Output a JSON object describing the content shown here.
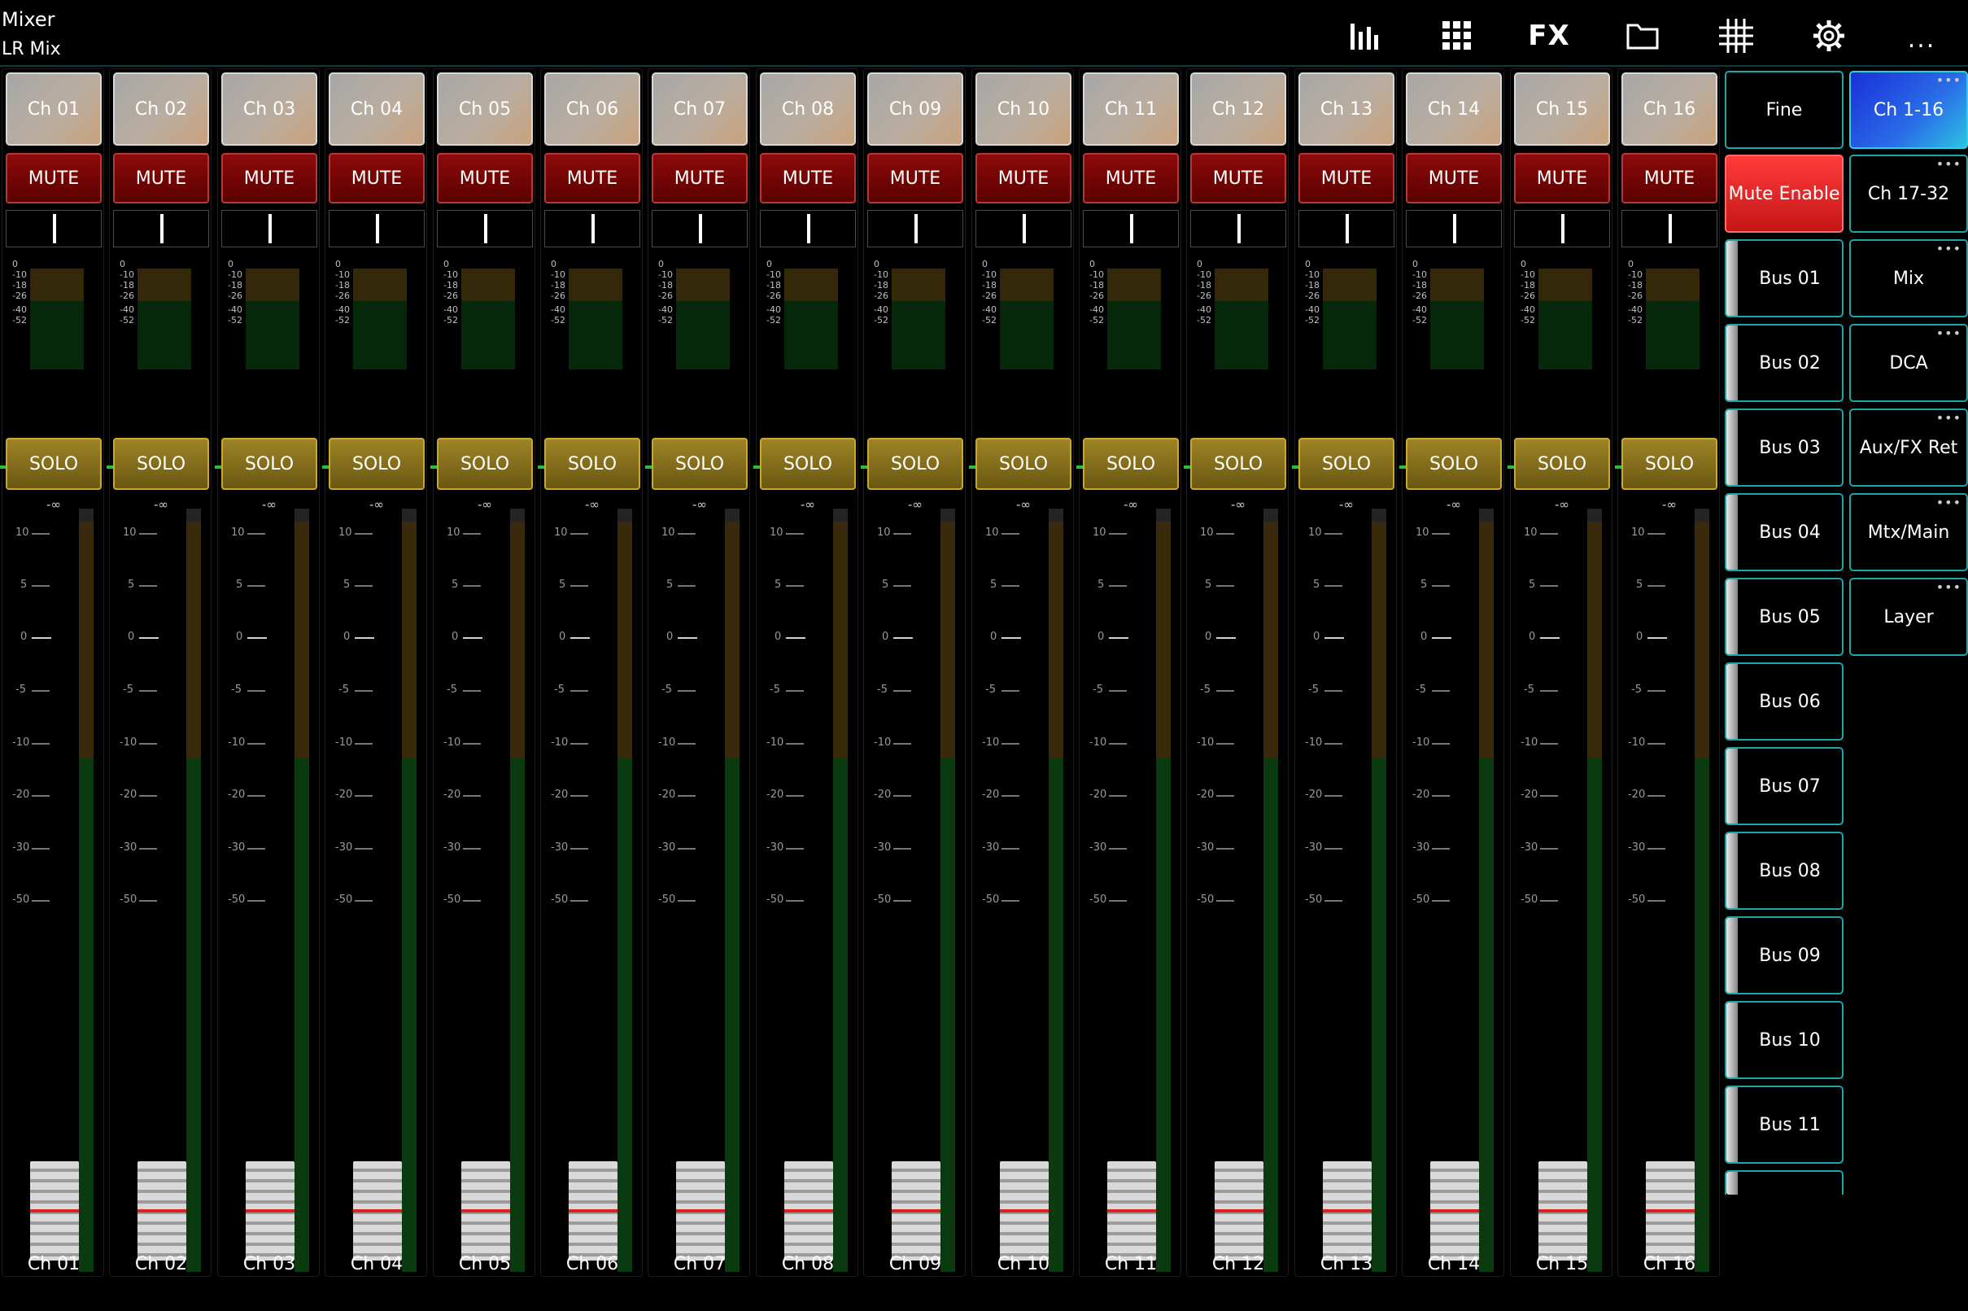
{
  "app": {
    "title": "Mixer",
    "subtitle": "LR Mix"
  },
  "toolbar": {
    "icons": [
      "meters-icon",
      "grid-icon",
      "fx-icon",
      "folder-icon",
      "routing-grid-icon",
      "gear-icon",
      "more-icon"
    ],
    "fx_label": "FX",
    "more_label": "..."
  },
  "channels": [
    {
      "name": "Ch 01"
    },
    {
      "name": "Ch 02"
    },
    {
      "name": "Ch 03"
    },
    {
      "name": "Ch 04"
    },
    {
      "name": "Ch 05"
    },
    {
      "name": "Ch 06"
    },
    {
      "name": "Ch 07"
    },
    {
      "name": "Ch 08"
    },
    {
      "name": "Ch 09"
    },
    {
      "name": "Ch 10"
    },
    {
      "name": "Ch 11"
    },
    {
      "name": "Ch 12"
    },
    {
      "name": "Ch 13"
    },
    {
      "name": "Ch 14"
    },
    {
      "name": "Ch 15"
    },
    {
      "name": "Ch 16"
    }
  ],
  "strip_labels": {
    "mute": "MUTE",
    "solo": "SOLO",
    "fader_readout": "-∞"
  },
  "gate_scale": [
    "0",
    "-10",
    "-18",
    "-26",
    "-40",
    "-52"
  ],
  "fader_scale": [
    "10",
    "5",
    "0",
    "-5",
    "-10",
    "-20",
    "-30",
    "-50"
  ],
  "right_panel": {
    "fine": "Fine",
    "mute_enable": "Mute Enable",
    "layers": [
      {
        "label": "Ch 1-16",
        "active": true
      },
      {
        "label": "Ch 17-32",
        "active": false
      },
      {
        "label": "Mix",
        "active": false
      },
      {
        "label": "DCA",
        "active": false
      },
      {
        "label": "Aux/FX Ret",
        "active": false
      },
      {
        "label": "Mtx/Main",
        "active": false
      },
      {
        "label": "Layer",
        "active": false
      }
    ],
    "more_dots": "•••",
    "buses": [
      "Bus 01",
      "Bus 02",
      "Bus 03",
      "Bus 04",
      "Bus 05",
      "Bus 06",
      "Bus 07",
      "Bus 08",
      "Bus 09",
      "Bus 10",
      "Bus 11"
    ]
  },
  "colors": {
    "accent": "#1aa7a7",
    "mute": "#7a0000",
    "solo": "#8a7420",
    "mute_enable": "#ff2a2a",
    "layer_active": "#2456e6"
  }
}
